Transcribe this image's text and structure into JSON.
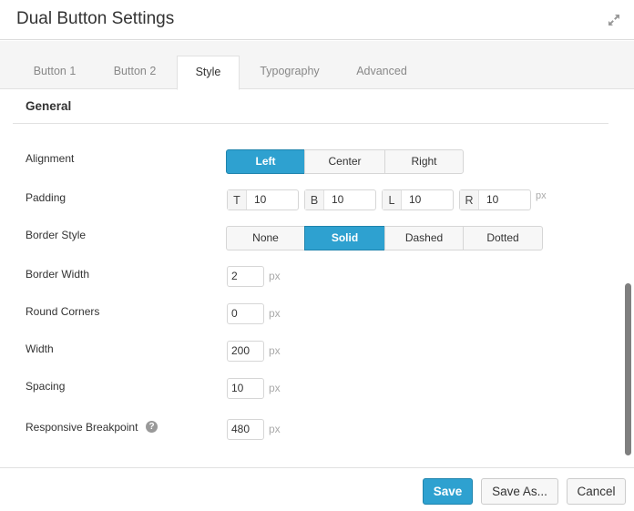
{
  "header": {
    "title": "Dual Button Settings",
    "expand_icon": "expand-arrows-icon"
  },
  "tabs": [
    {
      "label": "Button 1",
      "active": false
    },
    {
      "label": "Button 2",
      "active": false
    },
    {
      "label": "Style",
      "active": true
    },
    {
      "label": "Typography",
      "active": false
    },
    {
      "label": "Advanced",
      "active": false
    }
  ],
  "section": {
    "title": "General"
  },
  "fields": {
    "alignment": {
      "label": "Alignment",
      "options": [
        "Left",
        "Center",
        "Right"
      ],
      "selected": "Left"
    },
    "padding": {
      "label": "Padding",
      "sides": [
        {
          "prefix": "T",
          "value": "10"
        },
        {
          "prefix": "B",
          "value": "10"
        },
        {
          "prefix": "L",
          "value": "10"
        },
        {
          "prefix": "R",
          "value": "10"
        }
      ],
      "unit": "px"
    },
    "border_style": {
      "label": "Border Style",
      "options": [
        "None",
        "Solid",
        "Dashed",
        "Dotted"
      ],
      "selected": "Solid"
    },
    "border_width": {
      "label": "Border Width",
      "value": "2",
      "unit": "px"
    },
    "round_corners": {
      "label": "Round Corners",
      "value": "0",
      "unit": "px"
    },
    "width": {
      "label": "Width",
      "value": "200",
      "unit": "px"
    },
    "spacing": {
      "label": "Spacing",
      "value": "10",
      "unit": "px"
    },
    "responsive_breakpoint": {
      "label": "Responsive Breakpoint",
      "value": "480",
      "unit": "px",
      "help_icon": "?"
    }
  },
  "footer": {
    "save": "Save",
    "save_as": "Save As...",
    "cancel": "Cancel"
  },
  "colors": {
    "accent": "#2ea1d0"
  }
}
